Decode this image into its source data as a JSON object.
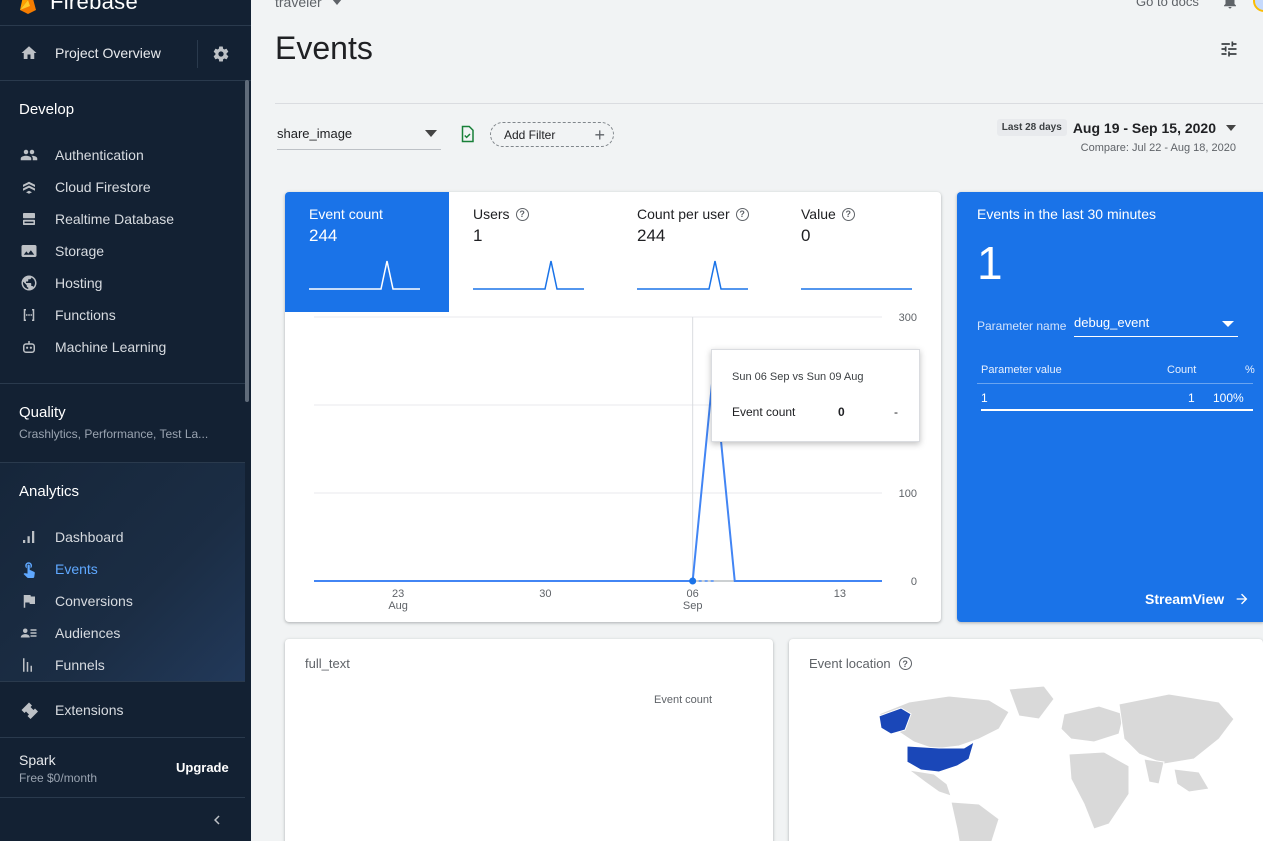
{
  "brand": {
    "name": "Firebase"
  },
  "sidebar": {
    "project_overview": "Project Overview",
    "develop": {
      "title": "Develop",
      "items": [
        {
          "label": "Authentication",
          "icon": "people-icon"
        },
        {
          "label": "Cloud Firestore",
          "icon": "firestore-icon"
        },
        {
          "label": "Realtime Database",
          "icon": "database-icon"
        },
        {
          "label": "Storage",
          "icon": "image-icon"
        },
        {
          "label": "Hosting",
          "icon": "globe-icon"
        },
        {
          "label": "Functions",
          "icon": "functions-icon"
        },
        {
          "label": "Machine Learning",
          "icon": "robot-icon"
        }
      ]
    },
    "quality": {
      "title": "Quality",
      "subtitle": "Crashlytics, Performance, Test La..."
    },
    "analytics": {
      "title": "Analytics",
      "items": [
        {
          "label": "Dashboard",
          "icon": "bar-chart-icon"
        },
        {
          "label": "Events",
          "icon": "touch-icon",
          "active": true
        },
        {
          "label": "Conversions",
          "icon": "flag-icon"
        },
        {
          "label": "Audiences",
          "icon": "audience-icon"
        },
        {
          "label": "Funnels",
          "icon": "funnel-icon"
        }
      ]
    },
    "extensions": "Extensions",
    "plan": {
      "name": "Spark",
      "price": "Free $0/month",
      "upgrade": "Upgrade"
    }
  },
  "topbar": {
    "project": "traveler",
    "docs": "Go to docs"
  },
  "page": {
    "title": "Events"
  },
  "filters": {
    "event": "share_image",
    "add_filter": "Add Filter",
    "date_chip": "Last 28 days",
    "date_range": "Aug 19 - Sep 15, 2020",
    "compare": "Compare: Jul 22 - Aug 18, 2020"
  },
  "metrics": [
    {
      "label": "Event count",
      "value": "244",
      "help": false,
      "selected": true
    },
    {
      "label": "Users",
      "value": "1",
      "help": true,
      "selected": false
    },
    {
      "label": "Count per user",
      "value": "244",
      "help": true,
      "selected": false
    },
    {
      "label": "Value",
      "value": "0",
      "help": true,
      "selected": false
    }
  ],
  "chart_data": {
    "type": "line",
    "title": "",
    "y_ticks": [
      "300",
      "100",
      "0"
    ],
    "ylim": [
      0,
      300
    ],
    "x_ticks": [
      {
        "day": "23",
        "month": "Aug"
      },
      {
        "day": "30",
        "month": ""
      },
      {
        "day": "06",
        "month": "Sep"
      },
      {
        "day": "13",
        "month": ""
      }
    ],
    "x": [
      "Aug 19",
      "Aug 20",
      "Aug 21",
      "Aug 22",
      "Aug 23",
      "Aug 24",
      "Aug 25",
      "Aug 26",
      "Aug 27",
      "Aug 28",
      "Aug 29",
      "Aug 30",
      "Aug 31",
      "Sep 1",
      "Sep 2",
      "Sep 3",
      "Sep 4",
      "Sep 5",
      "Sep 6",
      "Sep 7",
      "Sep 8",
      "Sep 9",
      "Sep 10",
      "Sep 11",
      "Sep 12",
      "Sep 13",
      "Sep 14",
      "Sep 15"
    ],
    "series": [
      {
        "values": [
          0,
          0,
          0,
          0,
          0,
          0,
          0,
          0,
          0,
          0,
          0,
          0,
          0,
          0,
          0,
          0,
          0,
          0,
          0,
          244,
          0,
          0,
          0,
          0,
          0,
          0,
          0,
          0
        ],
        "color": "#4285f4"
      },
      {
        "values": [
          0,
          0,
          0,
          0,
          0,
          0,
          0,
          0,
          0,
          0,
          0,
          0,
          0,
          0,
          0,
          0,
          0,
          0,
          0,
          0,
          0,
          0,
          0,
          0,
          0,
          0,
          0,
          0
        ],
        "color": "#4285f4",
        "dashed": true
      }
    ],
    "hover_index": 18,
    "grid": true
  },
  "tooltip": {
    "title": "Sun 06 Sep vs Sun 09 Aug",
    "label": "Event count",
    "value": "0",
    "change": "-"
  },
  "realtime": {
    "title": "Events in the last 30 minutes",
    "count": "1",
    "param_label": "Parameter name",
    "param_value": "debug_event",
    "headers": {
      "value": "Parameter value",
      "count": "Count",
      "pct": "%"
    },
    "rows": [
      {
        "value": "1",
        "count": "1",
        "pct": "100%"
      }
    ],
    "streamview": "StreamView"
  },
  "full_text": {
    "title": "full_text",
    "header": "Event count"
  },
  "event_location": {
    "title": "Event location"
  },
  "colors": {
    "primary": "#1a73e8",
    "sidebar": "#132133",
    "line": "#4285f4",
    "map_highlight": "#1a47b8",
    "map_base": "#d9d9d9"
  }
}
